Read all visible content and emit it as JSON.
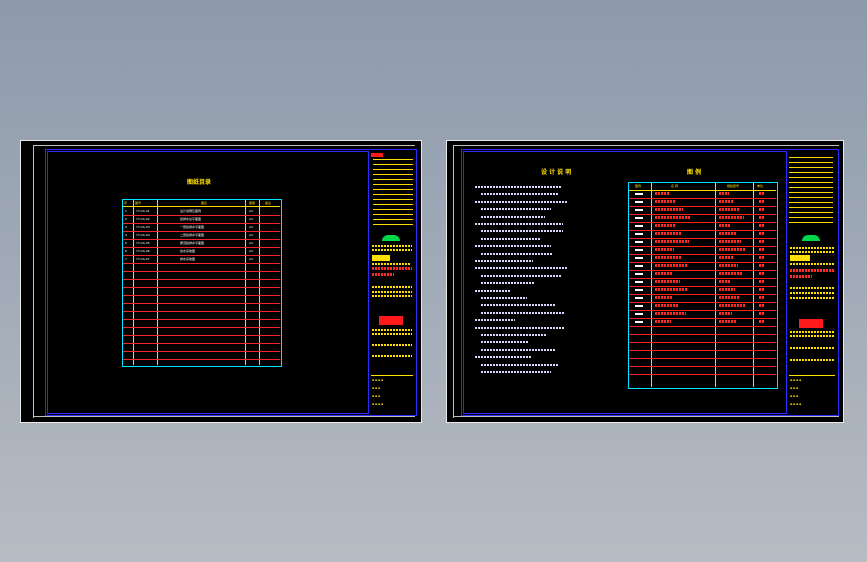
{
  "left_sheet": {
    "title": "图纸目录",
    "header": {
      "no": "序",
      "code": "图号",
      "name": "图名",
      "size": "图幅",
      "note": "备注"
    },
    "rows": [
      {
        "no": "1",
        "code": "YY-GS-01",
        "name": "设计说明及图例",
        "size": "A3"
      },
      {
        "no": "2",
        "code": "YY-GS-02",
        "name": "给排水总平面图",
        "size": "A3"
      },
      {
        "no": "3",
        "code": "YY-GS-03",
        "name": "一层给排水平面图",
        "size": "A3"
      },
      {
        "no": "4",
        "code": "YY-GS-04",
        "name": "二层给排水平面图",
        "size": "A3"
      },
      {
        "no": "5",
        "code": "YY-GS-05",
        "name": "屋顶给排水平面图",
        "size": "A3"
      },
      {
        "no": "6",
        "code": "YY-GS-06",
        "name": "给水系统图",
        "size": "A3"
      },
      {
        "no": "7",
        "code": "YY-GS-07",
        "name": "排水系统图",
        "size": "A3"
      }
    ],
    "empty_rows": 12,
    "title_block": {
      "logo": "logo-icon",
      "labels": [
        "设计",
        "校对",
        "审核",
        "审定",
        "日期",
        "图号"
      ]
    }
  },
  "right_sheet": {
    "notes_title": "设 计 说 明",
    "legend_title": "图 例",
    "legend_header": {
      "symbol": "图例",
      "name": "名 称",
      "spec": "规格型号",
      "unit": "单位"
    },
    "legend_rows": 17,
    "notes_lines": 26
  },
  "colors": {
    "background": "#000000",
    "frame": "#2a2aff",
    "table": "#00e5ff",
    "rows": "#ff2020",
    "text": "#ffe000"
  }
}
